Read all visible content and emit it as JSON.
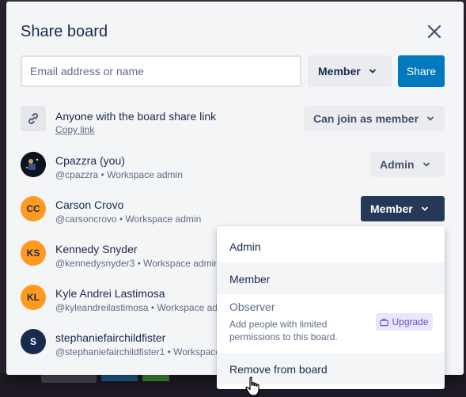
{
  "dialog": {
    "title": "Share board",
    "close_icon": "close-icon"
  },
  "invite": {
    "email_placeholder": "Email address or name",
    "email_value": "",
    "role_label": "Member",
    "share_label": "Share"
  },
  "share_link": {
    "icon": "link-icon",
    "title": "Anyone with the board share link",
    "copy_label": "Copy link",
    "permission_label": "Can join as member"
  },
  "members": [
    {
      "name": "Cpazzra (you)",
      "handle": "@cpazzra",
      "sep": " • ",
      "role_text": "Workspace admin",
      "avatar": "photo",
      "initials": "",
      "board_role": "Admin"
    },
    {
      "name": "Carson Crovo",
      "handle": "@carsoncrovo",
      "sep": " • ",
      "role_text": "Workspace admin",
      "avatar": "orange",
      "initials": "CC",
      "board_role": "Member"
    },
    {
      "name": "Kennedy Snyder",
      "handle": "@kennedysnyder3",
      "sep": " • ",
      "role_text": "Workspace admin",
      "avatar": "orange",
      "initials": "KS",
      "board_role": ""
    },
    {
      "name": "Kyle Andrei Lastimosa",
      "handle": "@kyleandreilastimosa",
      "sep": " • ",
      "role_text": "Workspace admin",
      "avatar": "orange",
      "initials": "KL",
      "board_role": ""
    },
    {
      "name": "stephaniefairchildfister",
      "handle": "@stephaniefairchildfister1",
      "sep": " • ",
      "role_text": "Workspace admin",
      "avatar": "navy",
      "initials": "S",
      "board_role": ""
    }
  ],
  "role_menu": {
    "items": [
      {
        "label": "Admin"
      },
      {
        "label": "Member"
      },
      {
        "label": "Observer",
        "description": "Add people with limited permissions to this board.",
        "badge": "Upgrade",
        "badge_icon": "briefcase-icon"
      },
      {
        "label": "Remove from board"
      }
    ]
  },
  "colors": {
    "primary": "#0079bf",
    "active_role": "#253858",
    "avatar_orange": "#ff991f",
    "upgrade_purple": "#6554c0"
  }
}
